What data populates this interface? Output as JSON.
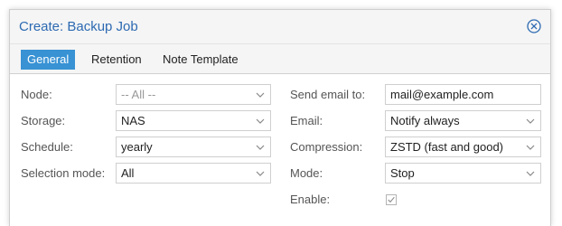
{
  "dialog": {
    "title": "Create: Backup Job"
  },
  "tabs": [
    {
      "label": "General",
      "active": true
    },
    {
      "label": "Retention",
      "active": false
    },
    {
      "label": "Note Template",
      "active": false
    }
  ],
  "left_form": {
    "node": {
      "label": "Node:",
      "placeholder": "-- All --"
    },
    "storage": {
      "label": "Storage:",
      "value": "NAS"
    },
    "schedule": {
      "label": "Schedule:",
      "value": "yearly"
    },
    "selection_mode": {
      "label": "Selection mode:",
      "value": "All"
    }
  },
  "right_form": {
    "send_email_to": {
      "label": "Send email to:",
      "value": "mail@example.com"
    },
    "email": {
      "label": "Email:",
      "value": "Notify always"
    },
    "compression": {
      "label": "Compression:",
      "value": "ZSTD (fast and good)"
    },
    "mode": {
      "label": "Mode:",
      "value": "Stop"
    },
    "enable": {
      "label": "Enable:",
      "checked": true
    }
  },
  "colors": {
    "accent": "#3892d4",
    "title": "#2d6ab2"
  },
  "icons": {
    "close": "close-icon",
    "dropdown": "chevron-down-icon",
    "check": "checkmark-icon"
  }
}
